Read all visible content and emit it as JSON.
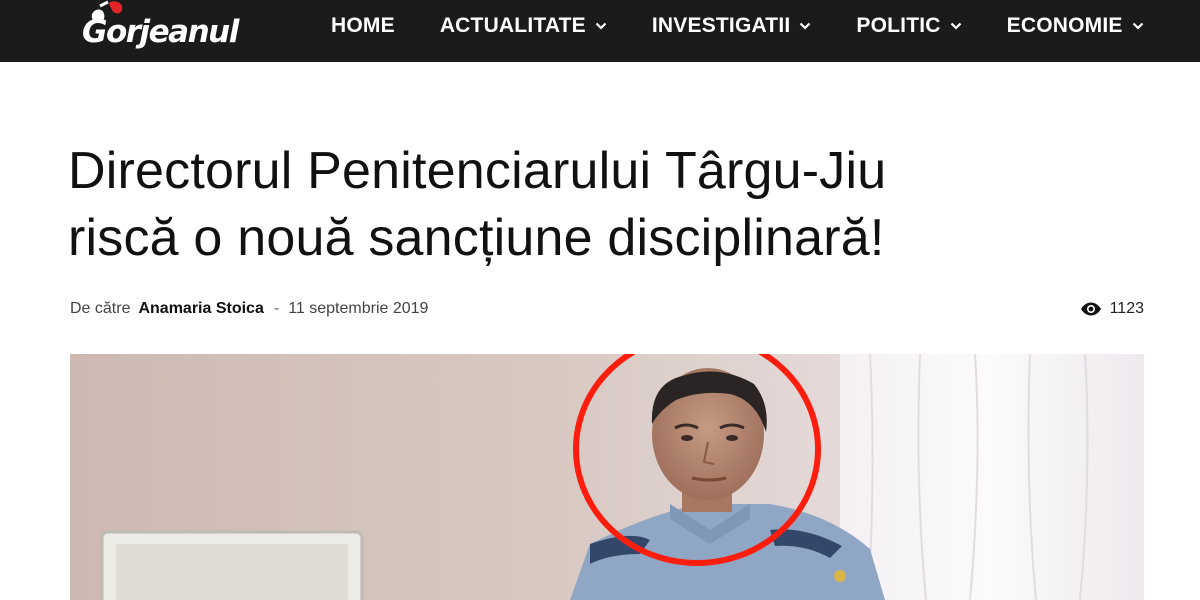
{
  "site": {
    "logo_text": "Gorjeanul"
  },
  "nav": {
    "items": [
      {
        "label": "HOME",
        "has_dropdown": false
      },
      {
        "label": "ACTUALITATE",
        "has_dropdown": true
      },
      {
        "label": "INVESTIGATII",
        "has_dropdown": true
      },
      {
        "label": "POLITIC",
        "has_dropdown": true
      },
      {
        "label": "ECONOMIE",
        "has_dropdown": true
      }
    ]
  },
  "article": {
    "title_line1": "Directorul Penitenciarului Târgu-Jiu",
    "title_line2": "riscă o nouă sancțiune disciplinară!",
    "byline_prefix": "De către",
    "author": "Anamaria Stoica",
    "separator": "-",
    "date": "11 septembrie 2019",
    "views": "1123"
  },
  "colors": {
    "navbar_bg": "#1b1b1b",
    "highlight_circle": "#ff1e0e",
    "logo_accent": "#e3242b"
  },
  "icons": {
    "views": "eye-icon",
    "dropdown": "chevron-down-icon"
  }
}
